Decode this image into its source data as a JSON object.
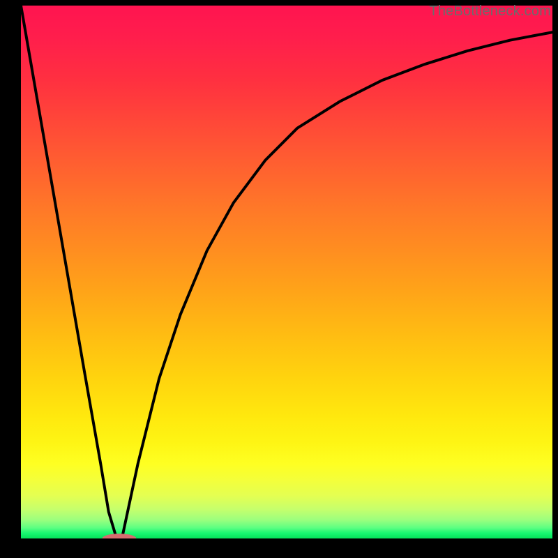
{
  "watermark": "TheBottleneck.com",
  "colors": {
    "frame": "#000000",
    "curve_stroke": "#000000",
    "marker_fill": "#d66d6f",
    "marker_stroke": "#a83f42"
  },
  "chart_data": {
    "type": "line",
    "title": "",
    "xlabel": "",
    "ylabel": "",
    "xlim": [
      0,
      100
    ],
    "ylim": [
      0,
      100
    ],
    "grid": false,
    "series": [
      {
        "name": "left-branch",
        "x": [
          0,
          4,
          8,
          12,
          15,
          16.5,
          18
        ],
        "values": [
          100,
          77,
          54,
          31,
          14,
          5,
          0
        ]
      },
      {
        "name": "right-branch",
        "x": [
          19,
          22,
          26,
          30,
          35,
          40,
          46,
          52,
          60,
          68,
          76,
          84,
          92,
          100
        ],
        "values": [
          0,
          14,
          30,
          42,
          54,
          63,
          71,
          77,
          82,
          86,
          89,
          91.5,
          93.5,
          95
        ]
      }
    ],
    "marker": {
      "name": "bottleneck-point",
      "x_center": 18.5,
      "y": 0,
      "rx_pct": 3.2,
      "ry_pct": 0.9
    },
    "background_gradient": {
      "direction": "vertical",
      "stops": [
        {
          "pos": 0,
          "color": "#ff1450"
        },
        {
          "pos": 50,
          "color": "#ff9a1c"
        },
        {
          "pos": 80,
          "color": "#fef514"
        },
        {
          "pos": 100,
          "color": "#04e25a"
        }
      ]
    }
  }
}
